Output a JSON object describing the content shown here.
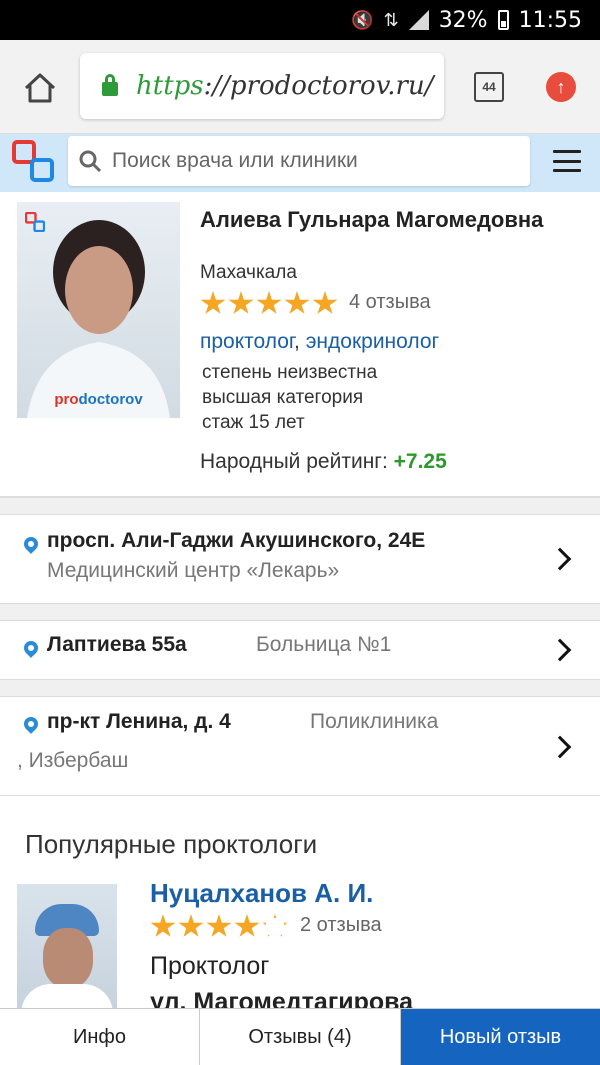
{
  "status_bar": {
    "battery": "32%",
    "time": "11:55"
  },
  "browser": {
    "url_scheme": "https",
    "url_rest": "://prodoctorov.ru/",
    "tab_count": "44"
  },
  "site_header": {
    "search_placeholder": "Поиск врача или клиники"
  },
  "doctor": {
    "name": "Алиева Гульнара Магомедовна",
    "city": "Махачкала",
    "stars": 5,
    "reviews": "4 отзыва",
    "specialty_1": "проктолог",
    "specialty_separator": ",",
    "specialty_2": "эндокринолог",
    "degree": "степень неизвестна",
    "category": "высшая категория",
    "experience": "стаж 15 лет",
    "rating_label": "Народный рейтинг:",
    "rating_value": "+7.25",
    "photo_watermark_pro": "pro",
    "photo_watermark_doctorov": "doctorov"
  },
  "addresses": [
    {
      "street": "просп. Али-Гаджи Акушинского, 24Е",
      "clinic": "Медицинский центр «Лекарь»"
    },
    {
      "street": "Лаптиева 55а",
      "clinic": "Больница №1"
    },
    {
      "street": "пр-кт Ленина, д. 4",
      "clinic": "Поликлиника",
      "city": ", Избербаш"
    }
  ],
  "popular": {
    "title": "Популярные проктологи",
    "doctor": {
      "name": "Нуцалханов А. И.",
      "stars": 4,
      "reviews": "2 отзыва",
      "specialty": "Проктолог",
      "address": "ул. Магомедтагирова"
    }
  },
  "bottom_nav": {
    "info": "Инфо",
    "reviews": "Отзывы (4)",
    "new_review": "Новый отзыв"
  },
  "colors": {
    "accent": "#1565c0",
    "link": "#1a5fa6",
    "rating_green": "#2b9a2b",
    "star": "#f5a623",
    "header_bg": "#cfe7f8"
  }
}
